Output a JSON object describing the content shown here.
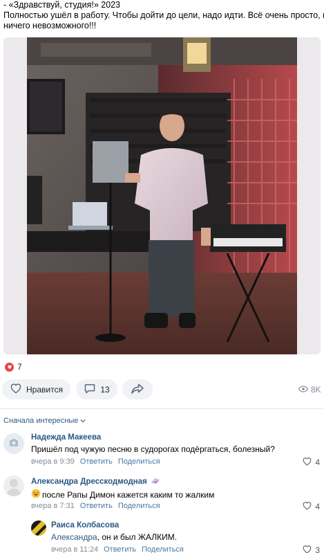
{
  "post": {
    "line1": "- «Здравствуй, студия!» 2023",
    "line2": "Полностью ушёл в работу. Чтобы дойти до цели, надо идти. Всё очень просто, нет",
    "line3": "ничего невозможного!!!"
  },
  "reactions": {
    "count": "7"
  },
  "actions": {
    "like_label": "Нравится",
    "comments_count": "13",
    "views": "8K"
  },
  "comments_sort": "Сначала интересные",
  "comments": [
    {
      "author": "Надежда Макеева",
      "text": "Пришёл под чужую песню в судорогах подёргаться, болезный?",
      "time": "вчера в 9:39",
      "reply": "Ответить",
      "share": "Поделиться",
      "likes": "4"
    },
    {
      "author": "Александра Дресскодмодная",
      "text": "после Рапы Димон кажется каким то жалким",
      "time": "вчера в 7:31",
      "reply": "Ответить",
      "share": "Поделиться",
      "likes": "4"
    },
    {
      "author": "Раиса Колбасова",
      "reply_to": "Александра",
      "text": ", он и был ЖАЛКИМ.",
      "time": "вчера в 11:24",
      "reply": "Ответить",
      "share": "Поделиться",
      "likes": "3"
    }
  ]
}
